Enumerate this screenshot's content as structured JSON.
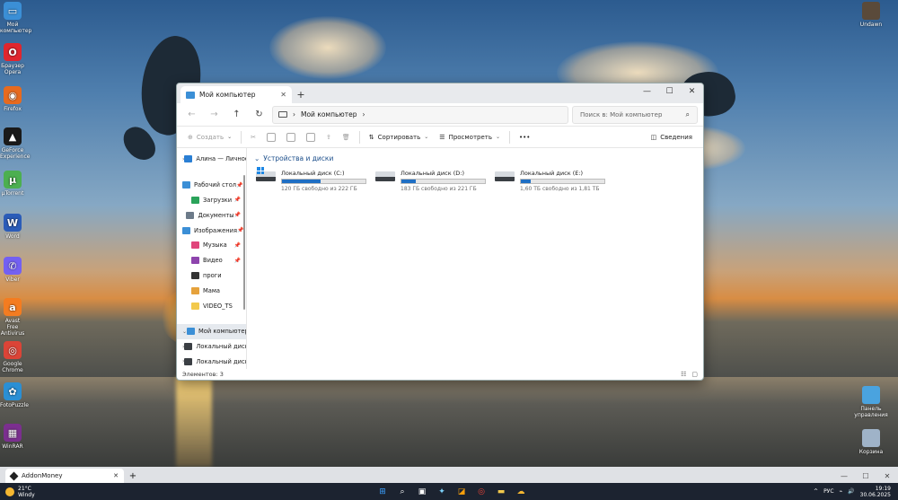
{
  "desktop": {
    "left_icons": [
      {
        "label": "Мой компьютер",
        "color": "#3b8fd6",
        "glyph": "▭"
      },
      {
        "label": "Браузер Opera",
        "color": "#e0262e",
        "glyph": "O"
      },
      {
        "label": "Firefox",
        "color": "#e66a1f",
        "glyph": "◉"
      },
      {
        "label": "GeForce Experience",
        "color": "#1a1a1a",
        "glyph": "▲"
      },
      {
        "label": "µTorrent",
        "color": "#4caf50",
        "glyph": "µ"
      },
      {
        "label": "Word",
        "color": "#2b5cb8",
        "glyph": "W"
      },
      {
        "label": "Viber",
        "color": "#7360f2",
        "glyph": "✆"
      },
      {
        "label": "Avast Free Antivirus",
        "color": "#f47c20",
        "glyph": "a"
      },
      {
        "label": "Google Chrome",
        "color": "#db4437",
        "glyph": "◎"
      },
      {
        "label": "FotoPuzzle",
        "color": "#2a8fd4",
        "glyph": "✿"
      },
      {
        "label": "WinRAR",
        "color": "#7b2f8f",
        "glyph": "▦"
      }
    ],
    "right_icons": [
      {
        "label": "Undawn",
        "color": "#5a4a3a"
      },
      {
        "label": "Панель управления",
        "color": "#4aa3df"
      },
      {
        "label": "Корзина",
        "color": "#9fb3c8"
      }
    ]
  },
  "explorer": {
    "tab_title": "Мой компьютер",
    "close_tab": "✕",
    "new_tab": "+",
    "window_controls": {
      "minimize": "—",
      "maximize": "☐",
      "close": "✕"
    },
    "nav": {
      "back": "←",
      "forward": "→",
      "up": "↑",
      "refresh": "↻"
    },
    "address": "Мой компьютер",
    "address_chevron": "›",
    "search_placeholder": "Поиск в: Мой компьютер",
    "toolbar": {
      "create": "Создать",
      "sort": "Сортировать",
      "view": "Просмотреть",
      "more": "•••",
      "details": "Сведения"
    },
    "sidebar": [
      {
        "label": "Алина — Личное",
        "color": "#2a7fd4",
        "chevron": "›",
        "pin": ""
      },
      {
        "label": "Рабочий стол",
        "color": "#3b8fd6",
        "chevron": "",
        "pin": "📌"
      },
      {
        "label": "Загрузки",
        "color": "#2aa35a",
        "chevron": "",
        "pin": "📌"
      },
      {
        "label": "Документы",
        "color": "#6c7a89",
        "chevron": "",
        "pin": "📌"
      },
      {
        "label": "Изображения",
        "color": "#3b8fd6",
        "chevron": "",
        "pin": "📌"
      },
      {
        "label": "Музыка",
        "color": "#e0457b",
        "chevron": "",
        "pin": "📌"
      },
      {
        "label": "Видео",
        "color": "#8e44ad",
        "chevron": "",
        "pin": "📌"
      },
      {
        "label": "проги",
        "color": "#333333",
        "chevron": "",
        "pin": ""
      },
      {
        "label": "Мама",
        "color": "#e6a23c",
        "chevron": "",
        "pin": ""
      },
      {
        "label": "VIDEO_TS",
        "color": "#f2c94c",
        "chevron": "",
        "pin": ""
      },
      {
        "label": "Мой компьютер",
        "color": "#3b8fd6",
        "chevron": "⌄",
        "pin": ""
      },
      {
        "label": "Локальный диск (C:)",
        "color": "#3b3f44",
        "chevron": "›",
        "pin": ""
      },
      {
        "label": "Локальный диск (D:)",
        "color": "#3b3f44",
        "chevron": "›",
        "pin": ""
      }
    ],
    "group_title": "Устройства и диски",
    "group_chevron": "⌄",
    "drives": [
      {
        "name": "Локальный диск (C:)",
        "free": "120 ГБ свободно из 222 ГБ",
        "used_fraction": 0.46,
        "system": true
      },
      {
        "name": "Локальный диск (D:)",
        "free": "183 ГБ свободно из 221 ГБ",
        "used_fraction": 0.17,
        "system": false
      },
      {
        "name": "Локальный диск (E:)",
        "free": "1,60 ТБ свободно из 1,81 ТБ",
        "used_fraction": 0.12,
        "system": false
      }
    ],
    "status": "Элементов: 3",
    "view_icons": {
      "list": "☷",
      "tiles": "▢"
    }
  },
  "browser": {
    "tab_title": "AddonMoney",
    "close": "✕",
    "new_tab": "+",
    "controls": {
      "minimize": "—",
      "maximize": "☐",
      "close": "✕"
    }
  },
  "taskbar": {
    "weather_temp": "21°C",
    "weather_desc": "Windy",
    "apps": [
      {
        "name": "start-button",
        "glyph": "⊞",
        "color": "#3aa0ff"
      },
      {
        "name": "search",
        "glyph": "⌕",
        "color": "#ffffff"
      },
      {
        "name": "task-view",
        "glyph": "▣",
        "color": "#ffffff"
      },
      {
        "name": "copilot",
        "glyph": "✦",
        "color": "#7dd3fc"
      },
      {
        "name": "photos",
        "glyph": "◪",
        "color": "#f59e0b"
      },
      {
        "name": "chrome",
        "glyph": "◎",
        "color": "#ea4335"
      },
      {
        "name": "explorer",
        "glyph": "▬",
        "color": "#f2c94c"
      },
      {
        "name": "weather",
        "glyph": "☁",
        "color": "#f5b731"
      }
    ],
    "tray_up": "^",
    "language": "РУС",
    "time": "19:19",
    "date": "30.06.2025"
  }
}
